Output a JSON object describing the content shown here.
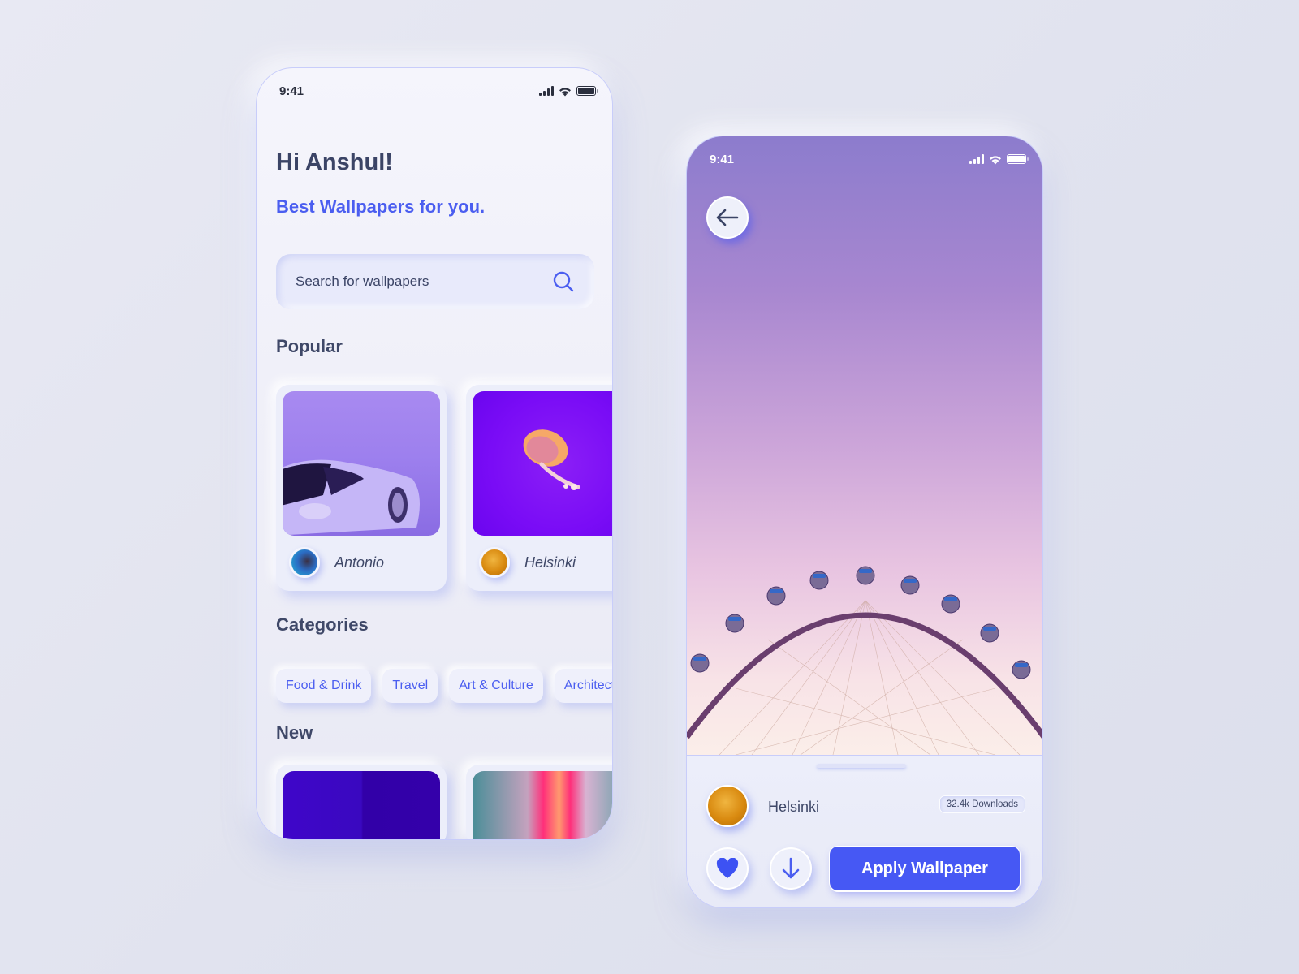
{
  "colors": {
    "accent": "#4b5ef0",
    "heading": "#3f4868",
    "button_primary": "#4658f4"
  },
  "home_screen": {
    "status_bar": {
      "time": "9:41"
    },
    "greeting": "Hi Anshul!",
    "subtitle": "Best Wallpapers for you.",
    "search": {
      "placeholder": "Search for wallpapers",
      "value": "",
      "icon": "search-icon"
    },
    "popular": {
      "title": "Popular",
      "items": [
        {
          "author": "Antonio",
          "image": "purple-convertible-car"
        },
        {
          "author": "Helsinki",
          "image": "orange-jellyfish-on-purple"
        }
      ]
    },
    "categories": {
      "title": "Categories",
      "items": [
        "Food & Drink",
        "Travel",
        "Art & Culture",
        "Architecture"
      ]
    },
    "new": {
      "title": "New",
      "items": [
        {
          "image": "indigo-abstract"
        },
        {
          "image": "neon-pink-corridor"
        }
      ]
    }
  },
  "detail_screen": {
    "status_bar": {
      "time": "9:41"
    },
    "back_icon": "arrow-left-icon",
    "wallpaper": "ferris-wheel-purple-sky",
    "author": "Helsinki",
    "downloads": "32.4k Downloads",
    "like_icon": "heart-icon",
    "download_icon": "arrow-down-icon",
    "apply_label": "Apply Wallpaper"
  }
}
